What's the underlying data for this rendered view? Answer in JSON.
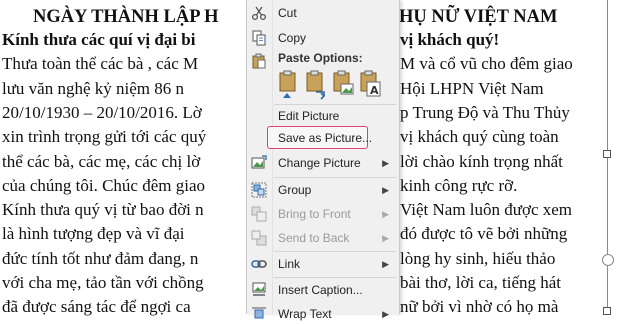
{
  "document": {
    "title_left": "NGÀY THÀNH LẬP H",
    "title_right": "HỤ NỮ VIỆT NAM",
    "lines": [
      {
        "left": "Kính thưa các quí vị đại bi",
        "right": "vị khách quý!",
        "bold": true
      },
      {
        "left": "Thưa toàn thể các bà , các M",
        "right": "M và cổ vũ cho đêm giao",
        "bold": false
      },
      {
        "left": "lưu văn nghệ kỷ niệm     86  n",
        "right": "Hội LHPN Việt Nam",
        "bold": false
      },
      {
        "left": "20/10/1930 – 20/10/2016. Lờ",
        "right": "p Trung Độ và Thu Thủy",
        "bold": false
      },
      {
        "left": "xin trình trọng gửi tới các quý",
        "right": "vị khách quý cùng toàn",
        "bold": false
      },
      {
        "left": "thể các bà, các mẹ, các chị lờ",
        "right": "lời chào kính trọng nhất",
        "bold": false
      },
      {
        "left": "của chúng tôi. Chúc đêm giao",
        "right": "kinh công rực rỡ.",
        "bold": false
      },
      {
        "left": "Kính thưa quý vị từ bao đời n",
        "right": "Việt Nam luôn được xem",
        "bold": false
      },
      {
        "left": "là hình tượng đẹp và vĩ đại",
        "right": "đó được tô vẽ bởi những",
        "bold": false
      },
      {
        "left": "đức tính tốt như đảm đang, n",
        "right": "lòng hy sinh, hiếu thảo",
        "bold": false
      },
      {
        "left": "với cha mẹ, tảo tần với chồng",
        "right": "bài thơ, lời ca, tiếng hát",
        "bold": false
      },
      {
        "left": "đã được sáng tác để ngợi ca",
        "right": "nữ bởi vì nhờ có họ mà",
        "bold": false
      }
    ]
  },
  "context_menu": {
    "items": [
      {
        "label": "Cut",
        "icon": "scissors-icon",
        "enabled": true,
        "submenu": false
      },
      {
        "label": "Copy",
        "icon": "copy-icon",
        "enabled": true,
        "submenu": false
      },
      {
        "label": "Paste Options:",
        "icon": "clipboard-icon",
        "enabled": true,
        "submenu": false
      },
      {
        "label": "Edit Picture",
        "icon": "",
        "enabled": true,
        "submenu": false
      },
      {
        "label": "Save as Picture...",
        "icon": "",
        "enabled": true,
        "submenu": false,
        "highlighted": true
      },
      {
        "label": "Change Picture",
        "icon": "change-picture-icon",
        "enabled": true,
        "submenu": true
      },
      {
        "label": "Group",
        "icon": "group-icon",
        "enabled": true,
        "submenu": true
      },
      {
        "label": "Bring to Front",
        "icon": "bring-to-front-icon",
        "enabled": false,
        "submenu": true
      },
      {
        "label": "Send to Back",
        "icon": "send-to-back-icon",
        "enabled": false,
        "submenu": true
      },
      {
        "label": "Link",
        "icon": "link-icon",
        "enabled": true,
        "submenu": true
      },
      {
        "label": "Insert Caption...",
        "icon": "insert-caption-icon",
        "enabled": true,
        "submenu": false
      },
      {
        "label": "Wrap Text",
        "icon": "wrap-text-icon",
        "enabled": true,
        "submenu": true
      }
    ],
    "accent_color": "#e0407a"
  }
}
